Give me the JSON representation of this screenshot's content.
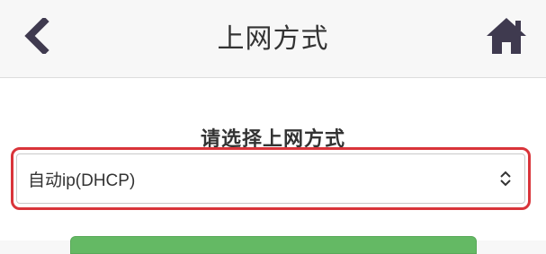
{
  "header": {
    "title": "上网方式",
    "back_icon": "chevron-left-icon",
    "home_icon": "home-icon"
  },
  "form": {
    "label": "请选择上网方式",
    "select": {
      "selected_value": "自动ip(DHCP)",
      "arrow_icon": "up-down-chevron-icon"
    }
  },
  "colors": {
    "header_bg": "#f7f7f7",
    "icon_color": "#3f3a4f",
    "highlight_border": "#d9343a",
    "button_green": "#64b964"
  }
}
